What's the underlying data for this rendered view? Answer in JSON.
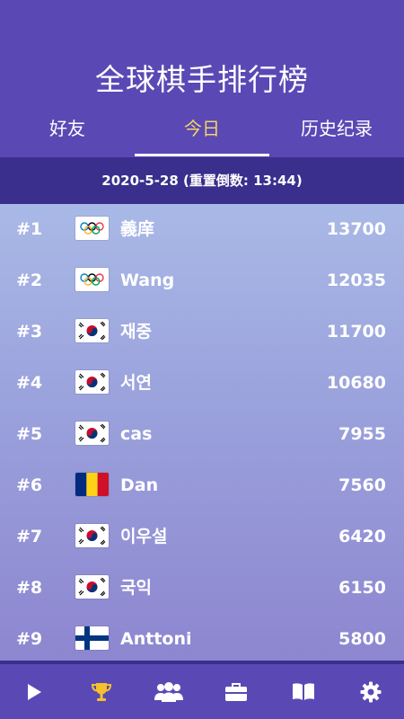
{
  "header": {
    "title": "全球棋手排行榜"
  },
  "tabs": [
    {
      "label": "好友",
      "active": false
    },
    {
      "label": "今日",
      "active": true
    },
    {
      "label": "历史纪录",
      "active": false
    }
  ],
  "subheader": {
    "text": "2020-5-28 (重置倒数: 13:44)"
  },
  "leaderboard": [
    {
      "rank": "#1",
      "flag": "olympic-flag-icon",
      "name": "義庠",
      "score": "13700"
    },
    {
      "rank": "#2",
      "flag": "olympic-flag-icon",
      "name": "Wang",
      "score": "12035"
    },
    {
      "rank": "#3",
      "flag": "south-korea-flag-icon",
      "name": "재중",
      "score": "11700"
    },
    {
      "rank": "#4",
      "flag": "south-korea-flag-icon",
      "name": "서연",
      "score": "10680"
    },
    {
      "rank": "#5",
      "flag": "south-korea-flag-icon",
      "name": "cas",
      "score": "7955"
    },
    {
      "rank": "#6",
      "flag": "romania-flag-icon",
      "name": "Dan",
      "score": "7560"
    },
    {
      "rank": "#7",
      "flag": "south-korea-flag-icon",
      "name": "이우설",
      "score": "6420"
    },
    {
      "rank": "#8",
      "flag": "south-korea-flag-icon",
      "name": "국익",
      "score": "6150"
    },
    {
      "rank": "#9",
      "flag": "finland-flag-icon",
      "name": "Anttoni",
      "score": "5800"
    }
  ],
  "bottom_nav": [
    {
      "icon": "play-icon",
      "active": false
    },
    {
      "icon": "trophy-icon",
      "active": true
    },
    {
      "icon": "friends-icon",
      "active": false
    },
    {
      "icon": "briefcase-icon",
      "active": false
    },
    {
      "icon": "book-icon",
      "active": false
    },
    {
      "icon": "gear-icon",
      "active": false
    }
  ],
  "colors": {
    "background": "#5a49b5",
    "subbar": "#3a2f8c",
    "active_tab": "#f6d365",
    "trophy": "#f6c12a"
  }
}
